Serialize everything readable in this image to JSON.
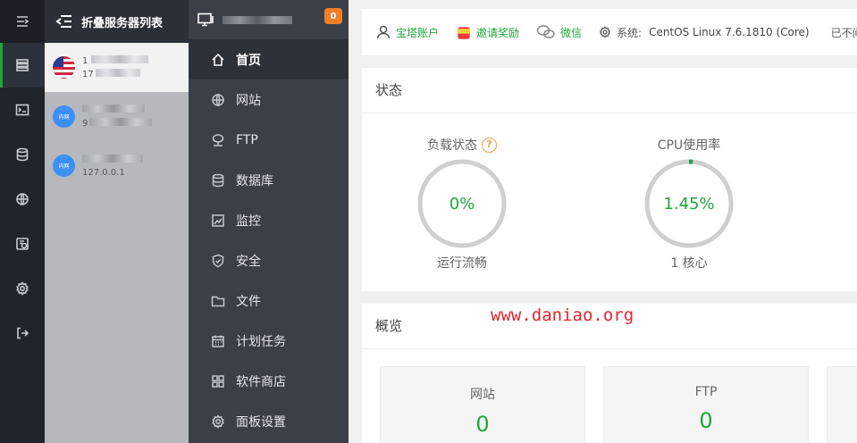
{
  "rail": {
    "items": [
      {
        "icon": "menu-collapse-icon"
      },
      {
        "icon": "server-list-icon",
        "active": true
      },
      {
        "icon": "terminal-icon"
      },
      {
        "icon": "database-icon"
      },
      {
        "icon": "globe-icon"
      },
      {
        "icon": "monitor-icon"
      },
      {
        "icon": "settings-icon"
      },
      {
        "icon": "logout-icon"
      }
    ]
  },
  "servers": {
    "title": "折叠服务器列表",
    "items": [
      {
        "flag": "us",
        "line1": "1",
        "line2": "17",
        "active": true
      },
      {
        "flag": "lan",
        "badge": "内网",
        "line1": "",
        "line2": "9"
      },
      {
        "flag": "lan",
        "badge": "内网",
        "line1": "",
        "line2": "127.0.0.1"
      }
    ]
  },
  "nav": {
    "badge": "0",
    "items": [
      {
        "label": "首页",
        "icon": "home-icon",
        "active": true
      },
      {
        "label": "网站",
        "icon": "globe-icon"
      },
      {
        "label": "FTP",
        "icon": "ftp-icon"
      },
      {
        "label": "数据库",
        "icon": "database-icon"
      },
      {
        "label": "监控",
        "icon": "monitor-icon"
      },
      {
        "label": "安全",
        "icon": "shield-icon"
      },
      {
        "label": "文件",
        "icon": "folder-icon"
      },
      {
        "label": "计划任务",
        "icon": "calendar-icon"
      },
      {
        "label": "软件商店",
        "icon": "grid-icon"
      },
      {
        "label": "面板设置",
        "icon": "gear-icon"
      }
    ]
  },
  "topbar": {
    "account": "宝塔账户",
    "invite": "邀请奖励",
    "wechat": "微信",
    "system_label": "系统:",
    "system_value": "CentOS Linux 7.6.1810 (Core)",
    "uptime_label": "已不间断运行"
  },
  "status": {
    "title": "状态",
    "load": {
      "label": "负载状态",
      "value": "0%",
      "percent": 0,
      "sub": "运行流畅"
    },
    "cpu": {
      "label": "CPU使用率",
      "value": "1.45%",
      "percent": 1.45,
      "sub": "1 核心"
    }
  },
  "overview": {
    "title": "概览",
    "items": [
      {
        "name": "网站",
        "value": "0"
      },
      {
        "name": "FTP",
        "value": "0"
      }
    ]
  },
  "watermark": "www.daniao.org",
  "colors": {
    "accent": "#20a53a",
    "badge": "#f07f2a",
    "watermark": "#e3242b"
  }
}
